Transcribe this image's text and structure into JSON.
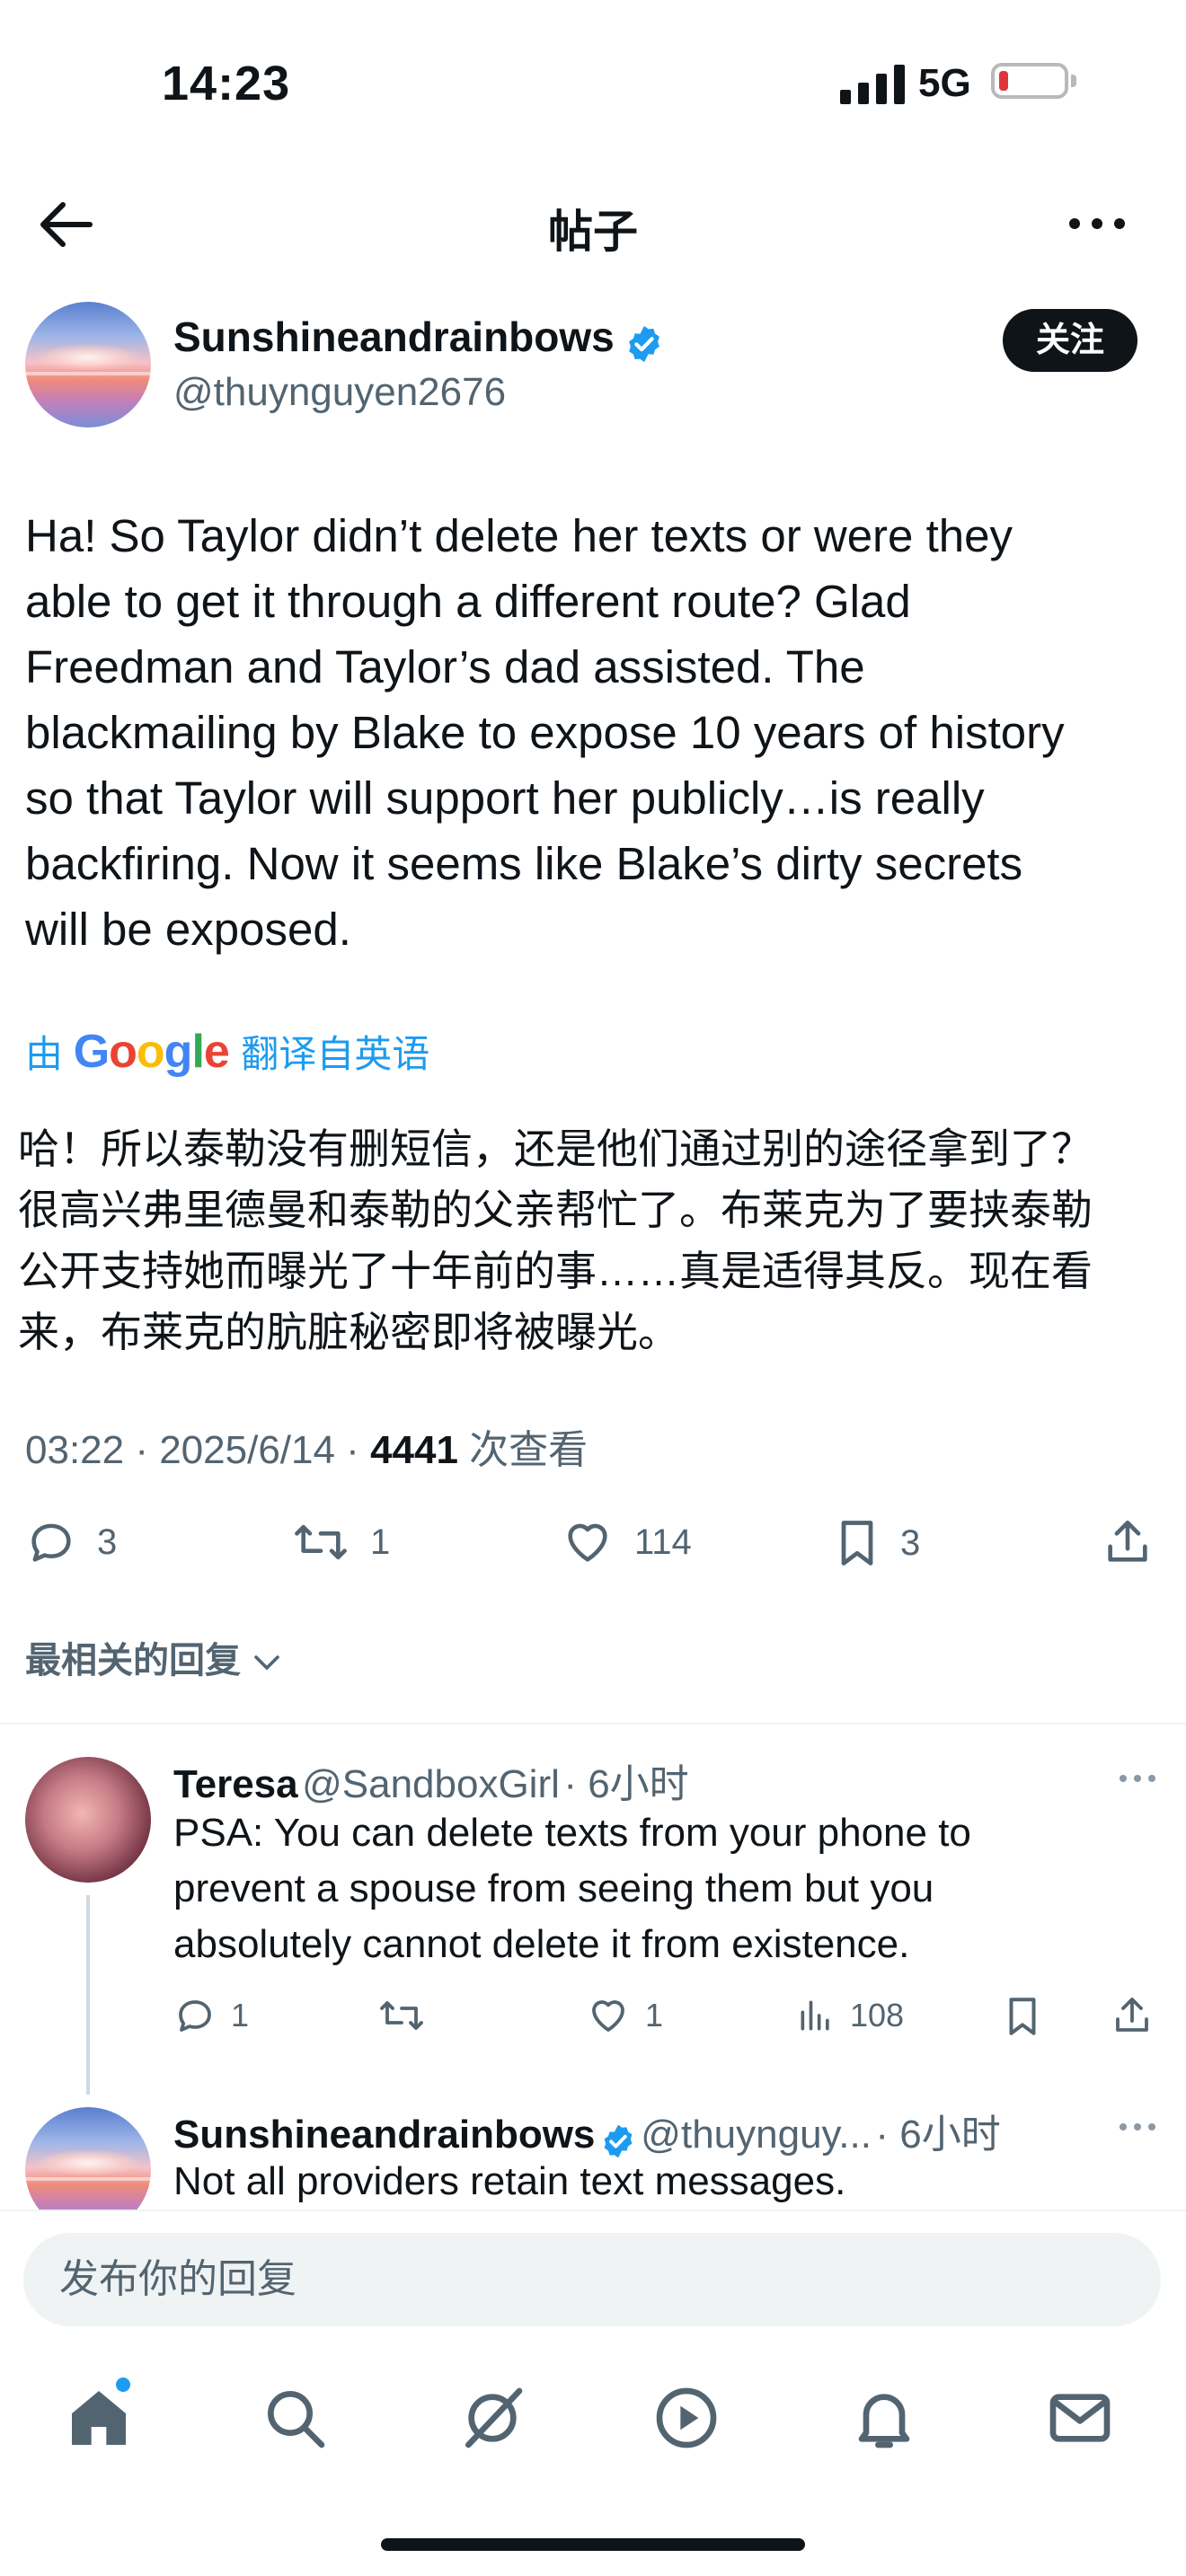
{
  "status_bar": {
    "time": "14:23",
    "network": "5G"
  },
  "header": {
    "title": "帖子"
  },
  "post": {
    "author_name": "Sunshineandrainbows",
    "author_handle": "@thuynguyen2676",
    "follow_label": "关注",
    "text_lines": [
      "Ha!  So Taylor didn’t delete her texts or were they",
      "able to get it through a different route?  Glad",
      "Freedman and Taylor’s dad assisted.   The",
      "blackmailing by Blake to expose 10 years of history",
      "so that Taylor will support her publicly…is really",
      "backfiring.   Now it seems like Blake’s dirty secrets",
      "will be exposed."
    ],
    "translate_prefix": "由",
    "translate_brand": "Google",
    "translate_suffix": "翻译自英语",
    "translated_lines": [
      "哈！所以泰勒没有删短信，还是他们通过别的途径拿到了？",
      "很高兴弗里德曼和泰勒的父亲帮忙了。布莱克为了要挟泰勒",
      "公开支持她而曝光了十年前的事……真是适得其反。现在看",
      "来，布莱克的肮脏秘密即将被曝光。"
    ],
    "timestamp": "03:22 · 2025/6/14 · ",
    "views_count": "4441",
    "views_label": " 次查看",
    "actions": {
      "replies": "3",
      "reposts": "1",
      "likes": "114",
      "bookmarks": "3"
    }
  },
  "sort_label": "最相关的回复",
  "replies": [
    {
      "name": "Teresa",
      "handle": "@SandboxGirl",
      "time": "· 6小时",
      "text_lines": [
        "PSA: You can delete texts from your phone to",
        "prevent a spouse from seeing them but you",
        "absolutely cannot delete it from existence."
      ],
      "actions": {
        "replies": "1",
        "reposts": "",
        "likes": "1",
        "views": "108"
      }
    },
    {
      "name": "Sunshineandrainbows",
      "handle": "@thuynguy...",
      "time": "· 6小时",
      "text_lines": [
        "Not all providers retain text messages."
      ]
    }
  ],
  "compose": {
    "placeholder": "发布你的回复"
  },
  "tabs": [
    "home-icon",
    "search-icon",
    "grok-icon",
    "video-icon",
    "notifications-icon",
    "messages-icon"
  ]
}
